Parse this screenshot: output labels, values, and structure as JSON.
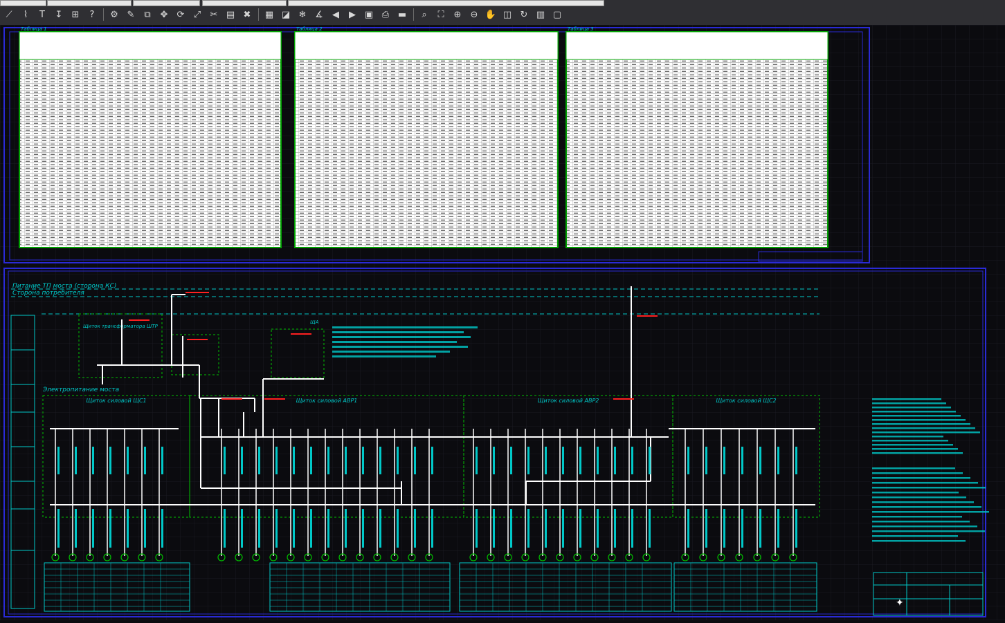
{
  "toolbar": {
    "buttons": [
      {
        "name": "line-tool-icon",
        "glyph": "⟋"
      },
      {
        "name": "polyline-tool-icon",
        "glyph": "⌇"
      },
      {
        "name": "text-tool-icon",
        "glyph": "T"
      },
      {
        "name": "dimension-tool-icon",
        "glyph": "↧"
      },
      {
        "name": "insert-block-icon",
        "glyph": "⊞"
      },
      {
        "name": "help-icon",
        "glyph": "?"
      },
      {
        "name": "sep"
      },
      {
        "name": "properties-icon",
        "glyph": "⚙"
      },
      {
        "name": "match-properties-icon",
        "glyph": "✎"
      },
      {
        "name": "copy-icon",
        "glyph": "⧉"
      },
      {
        "name": "move-icon",
        "glyph": "✥"
      },
      {
        "name": "rotate-icon",
        "glyph": "⟳"
      },
      {
        "name": "scale-icon",
        "glyph": "⤢"
      },
      {
        "name": "trim-icon",
        "glyph": "✂"
      },
      {
        "name": "layer-icon",
        "glyph": "▤"
      },
      {
        "name": "erase-icon",
        "glyph": "✖"
      },
      {
        "name": "sep"
      },
      {
        "name": "layer-manager-icon",
        "glyph": "▦"
      },
      {
        "name": "layer-states-icon",
        "glyph": "◪"
      },
      {
        "name": "layer-freeze-icon",
        "glyph": "❄"
      },
      {
        "name": "measure-icon",
        "glyph": "∡"
      },
      {
        "name": "back-arrow-icon",
        "glyph": "◀"
      },
      {
        "name": "forward-arrow-icon",
        "glyph": "▶"
      },
      {
        "name": "page-setup-icon",
        "glyph": "▣"
      },
      {
        "name": "print-icon",
        "glyph": "⎙"
      },
      {
        "name": "folder-icon",
        "glyph": "▬"
      },
      {
        "name": "sep"
      },
      {
        "name": "zoom-window-icon",
        "glyph": "⌕"
      },
      {
        "name": "zoom-extents-icon",
        "glyph": "⛶"
      },
      {
        "name": "zoom-realtime-icon",
        "glyph": "⊕"
      },
      {
        "name": "zoom-previous-icon",
        "glyph": "⊖"
      },
      {
        "name": "pan-icon",
        "glyph": "✋"
      },
      {
        "name": "named-views-icon",
        "glyph": "◫"
      },
      {
        "name": "regen-icon",
        "glyph": "↻"
      },
      {
        "name": "tool-palette-icon",
        "glyph": "▥"
      },
      {
        "name": "sheet-set-icon",
        "glyph": "▢"
      }
    ]
  },
  "colors": {
    "background": "#0b0b0f",
    "toolbar": "#2f2f33",
    "frame": "#2a2ad6",
    "table_bg": "#ffffff",
    "table_border": "#00a000",
    "cyan": "#00c8c8",
    "green": "#00c000",
    "red": "#ff2020",
    "white": "#ffffff"
  },
  "tables": {
    "t1": {
      "label": "Таблица 1"
    },
    "t2": {
      "label": "Таблица 2"
    },
    "t3": {
      "label": "Таблица 3"
    }
  },
  "scheme": {
    "supply_title": "Питание ТП моста (сторона КС)",
    "consumer_side": "Сторона потребителя",
    "bridge_power": "Электропитание моста",
    "panels": [
      {
        "label": "Щиток силовой ЩС1"
      },
      {
        "label": "Щиток силовой АВР1"
      },
      {
        "label": "Щиток силовой АВР2"
      },
      {
        "label": "Щиток силовой ЩС2"
      }
    ],
    "transformer_label": "Щиток трансформатора ШТР",
    "ups_label": "ЩА"
  }
}
